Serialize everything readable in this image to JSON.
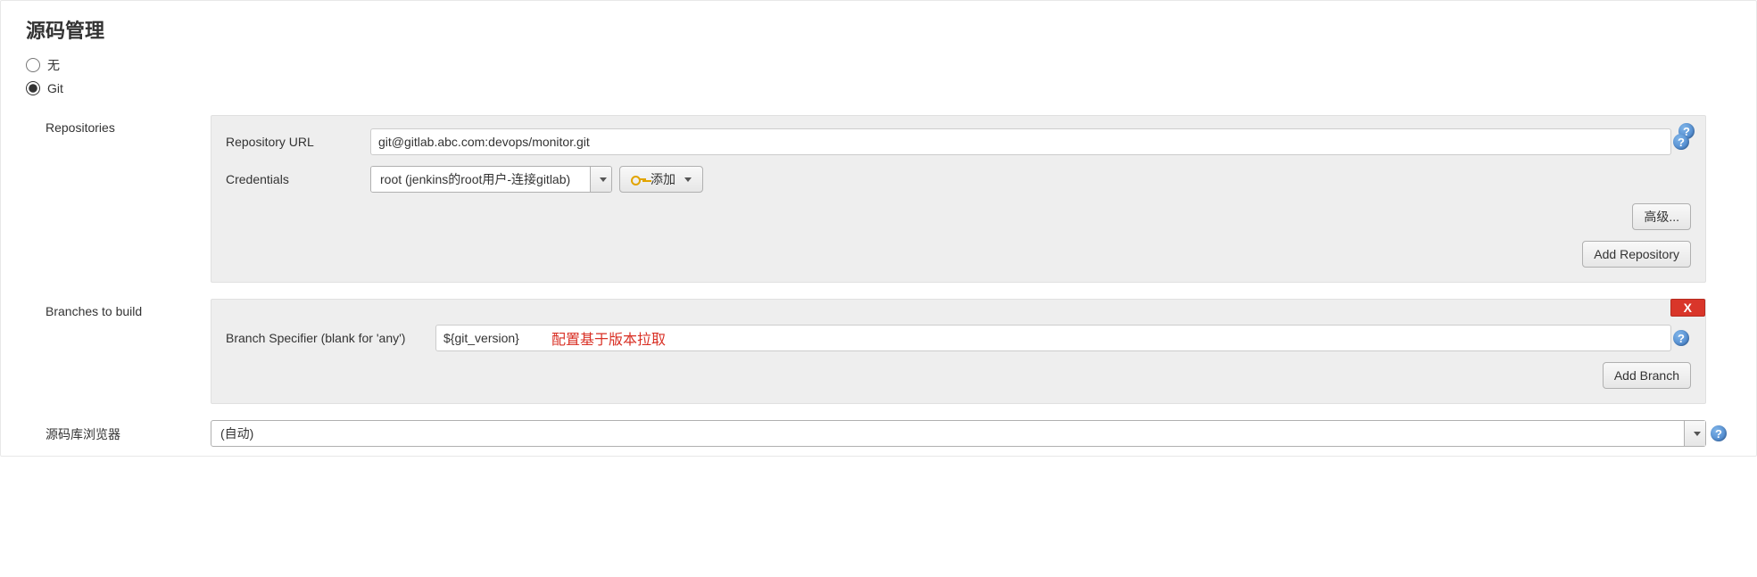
{
  "section": {
    "title": "源码管理"
  },
  "scm": {
    "none_label": "无",
    "git_label": "Git",
    "selected": "git"
  },
  "repositories": {
    "label": "Repositories",
    "url_label": "Repository URL",
    "url_value": "git@gitlab.abc.com:devops/monitor.git",
    "credentials_label": "Credentials",
    "credentials_value": "root (jenkins的root用户-连接gitlab)",
    "add_label": "添加",
    "advanced_label": "高级...",
    "add_repo_label": "Add Repository"
  },
  "branches": {
    "label": "Branches to build",
    "specifier_label": "Branch Specifier (blank for 'any')",
    "specifier_value": "${git_version}",
    "annotation": "配置基于版本拉取",
    "delete_label": "X",
    "add_branch_label": "Add Branch"
  },
  "browser": {
    "label": "源码库浏览器",
    "value": "(自动)"
  },
  "help_glyph": "?"
}
